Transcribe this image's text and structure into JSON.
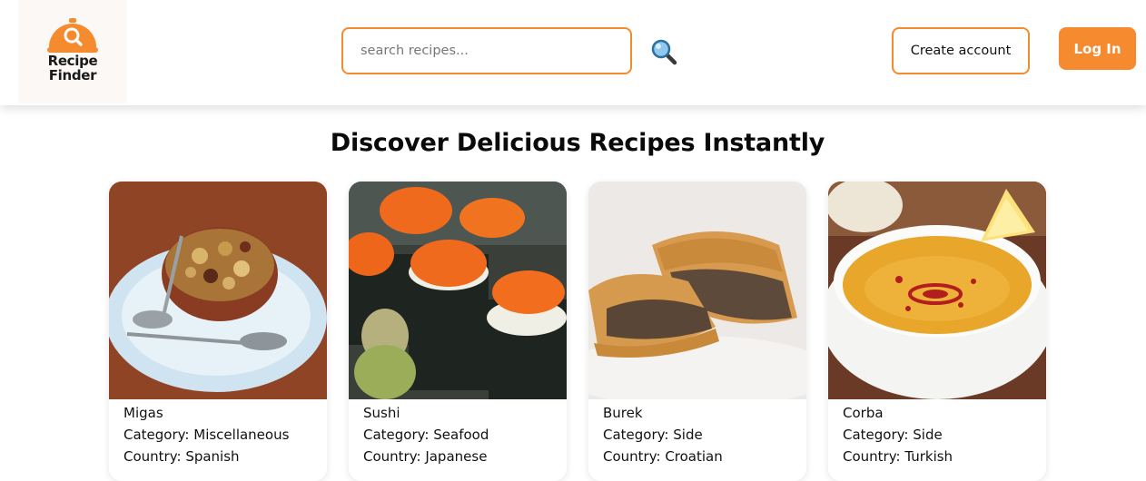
{
  "header": {
    "logo_line1": "Recipe",
    "logo_line2": "Finder",
    "search_placeholder": "search recipes...",
    "search_value": "",
    "create_account_label": "Create account",
    "login_label": "Log In"
  },
  "main": {
    "heading": "Discover Delicious Recipes Instantly"
  },
  "recipes": [
    {
      "name": "Migas",
      "category": "Category: Miscellaneous",
      "country": "Country: Spanish"
    },
    {
      "name": "Sushi",
      "category": "Category: Seafood",
      "country": "Country: Japanese"
    },
    {
      "name": "Burek",
      "category": "Category: Side",
      "country": "Country: Croatian"
    },
    {
      "name": "Corba",
      "category": "Category: Side",
      "country": "Country: Turkish"
    }
  ],
  "colors": {
    "accent": "#f58a2e",
    "background": "#ffffff"
  }
}
